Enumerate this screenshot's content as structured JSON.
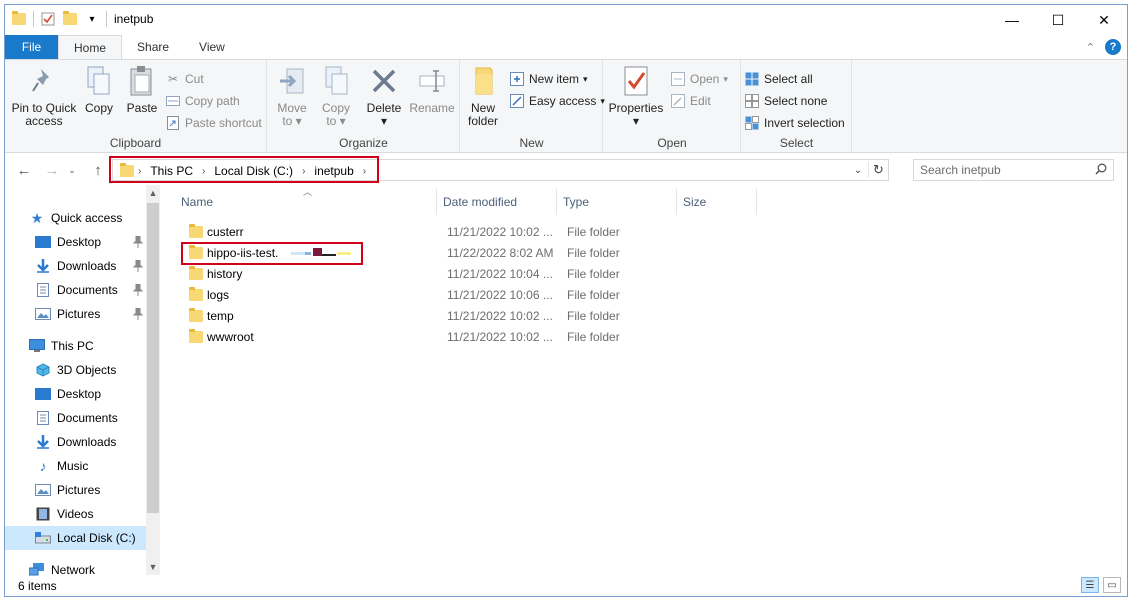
{
  "window": {
    "title": "inetpub",
    "controls": {
      "minimize": "—",
      "maximize": "☐",
      "close": "✕"
    }
  },
  "ribbon_tabs": [
    "File",
    "Home",
    "Share",
    "View"
  ],
  "ribbon": {
    "clipboard": {
      "label": "Clipboard",
      "pin_label_1": "Pin to Quick",
      "pin_label_2": "access",
      "copy": "Copy",
      "paste": "Paste",
      "cut": "Cut",
      "copy_path": "Copy path",
      "paste_shortcut": "Paste shortcut"
    },
    "organize": {
      "label": "Organize",
      "move_to_1": "Move",
      "move_to_2": "to",
      "copy_to_1": "Copy",
      "copy_to_2": "to",
      "delete": "Delete",
      "rename": "Rename"
    },
    "new": {
      "label": "New",
      "new_folder_1": "New",
      "new_folder_2": "folder",
      "new_item": "New item",
      "easy_access": "Easy access"
    },
    "open": {
      "label": "Open",
      "properties": "Properties",
      "open": "Open",
      "edit": "Edit"
    },
    "select": {
      "label": "Select",
      "select_all": "Select all",
      "select_none": "Select none",
      "invert_selection": "Invert selection"
    }
  },
  "address": {
    "crumbs": [
      "This PC",
      "Local Disk (C:)",
      "inetpub"
    ]
  },
  "search": {
    "placeholder": "Search inetpub"
  },
  "nav": {
    "quick_access": "Quick access",
    "quick_items": [
      "Desktop",
      "Downloads",
      "Documents",
      "Pictures"
    ],
    "this_pc": "This PC",
    "pc_items": [
      "3D Objects",
      "Desktop",
      "Documents",
      "Downloads",
      "Music",
      "Pictures",
      "Videos",
      "Local Disk (C:)"
    ],
    "network": "Network"
  },
  "columns": {
    "name": "Name",
    "date": "Date modified",
    "type": "Type",
    "size": "Size"
  },
  "files": [
    {
      "name": "custerr",
      "date": "11/21/2022 10:02 ...",
      "type": "File folder"
    },
    {
      "name": "hippo-iis-test.",
      "date": "11/22/2022 8:02 AM",
      "type": "File folder"
    },
    {
      "name": "history",
      "date": "11/21/2022 10:04 ...",
      "type": "File folder"
    },
    {
      "name": "logs",
      "date": "11/21/2022 10:06 ...",
      "type": "File folder"
    },
    {
      "name": "temp",
      "date": "11/21/2022 10:02 ...",
      "type": "File folder"
    },
    {
      "name": "wwwroot",
      "date": "11/21/2022 10:02 ...",
      "type": "File folder"
    }
  ],
  "status": {
    "item_count": "6 items"
  },
  "colors": {
    "accent": "#1979ca",
    "highlight": "#d0021b",
    "selected": "#cce8ff",
    "folder": "#f8d775"
  }
}
